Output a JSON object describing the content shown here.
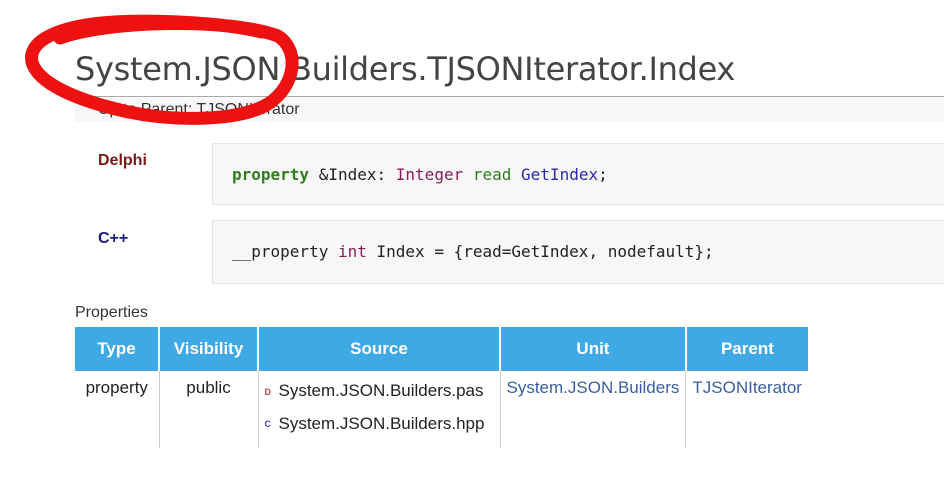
{
  "title": "System.JSON.Builders.TJSONIterator.Index",
  "breadcrumb": {
    "text": "Up to Parent: TJSONIterator"
  },
  "syntax": {
    "delphi": {
      "label": "Delphi",
      "kw_property": "property",
      "name": "&Index:",
      "type": "Integer",
      "kw_read": "read",
      "getter": "GetIndex",
      "end": ";"
    },
    "cpp": {
      "label": "C++",
      "kw_property": "__property",
      "type": "int",
      "rest": "Index = {read=GetIndex, nodefault};"
    }
  },
  "properties": {
    "caption": "Properties",
    "headers": [
      "Type",
      "Visibility",
      "Source",
      "Unit",
      "Parent"
    ],
    "row": {
      "type": "property",
      "visibility": "public",
      "sources": [
        {
          "icon": "D",
          "file": "System.JSON.Builders.pas"
        },
        {
          "icon": "C",
          "file": "System.JSON.Builders.hpp"
        }
      ],
      "unit": "System.JSON.Builders",
      "parent": "TJSONIterator"
    }
  },
  "annotation_color": "#ee1111"
}
